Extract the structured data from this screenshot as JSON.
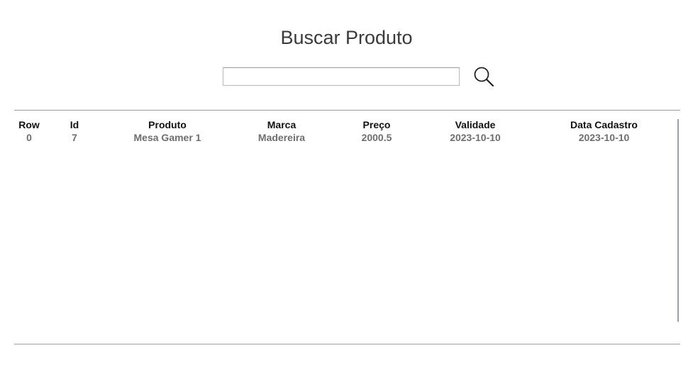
{
  "header": {
    "title": "Buscar Produto"
  },
  "search": {
    "value": "",
    "placeholder": "",
    "button_icon": "search-icon"
  },
  "table": {
    "columns": [
      "Row",
      "Id",
      "Produto",
      "Marca",
      "Preço",
      "Validade",
      "Data Cadastro"
    ],
    "rows": [
      [
        "0",
        "7",
        "Mesa Gamer 1",
        "Madereira",
        "2000.5",
        "2023-10-10",
        "2023-10-10"
      ]
    ]
  },
  "colors": {
    "header_text": "#111111",
    "cell_text": "#6e6e6e",
    "title_text": "#3a3a3a",
    "rule": "#9e9e9e"
  }
}
